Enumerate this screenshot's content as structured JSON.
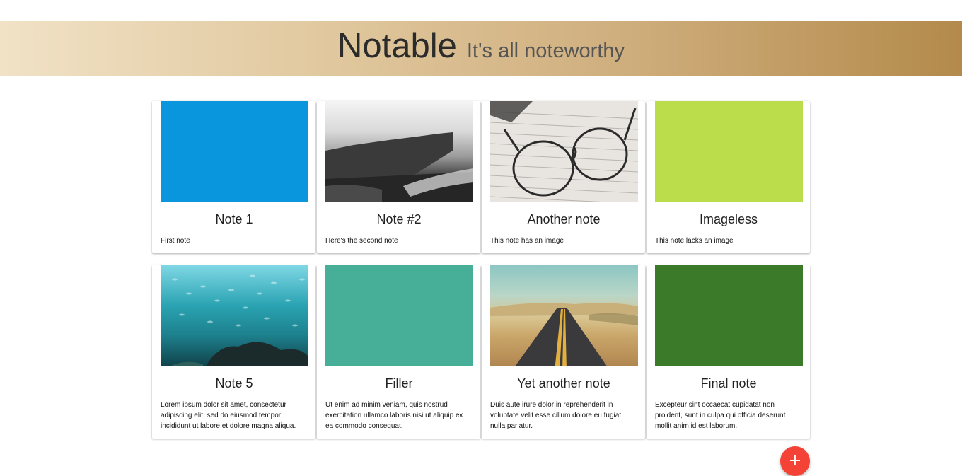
{
  "header": {
    "title": "Notable",
    "tagline": "It's all noteworthy"
  },
  "notes": [
    {
      "title": "Note 1",
      "text": "First note",
      "media": "solid-color",
      "color": "#0a96dd"
    },
    {
      "title": "Note #2",
      "text": "Here's the second note",
      "media": "photo-sea-cliffs-black-and-white"
    },
    {
      "title": "Another note",
      "text": "This note has an image",
      "media": "photo-eyeglasses-on-newspaper"
    },
    {
      "title": "Imageless",
      "text": "This note lacks an image",
      "media": "solid-color",
      "color": "#bbdd4c"
    },
    {
      "title": "Note 5",
      "text": "Lorem ipsum dolor sit amet, consectetur adipiscing elit, sed do eiusmod tempor incididunt ut labore et dolore magna aliqua.",
      "media": "photo-school-of-fish-reef"
    },
    {
      "title": "Filler",
      "text": "Ut enim ad minim veniam, quis nostrud exercitation ullamco laboris nisi ut aliquip ex ea commodo consequat.",
      "media": "solid-color",
      "color": "#47ae98"
    },
    {
      "title": "Yet another note",
      "text": "Duis aute irure dolor in reprehenderit in voluptate velit esse cillum dolore eu fugiat nulla pariatur.",
      "media": "photo-desert-road"
    },
    {
      "title": "Final note",
      "text": "Excepteur sint occaecat cupidatat non proident, sunt in culpa qui officia deserunt mollit anim id est laborum.",
      "media": "solid-color",
      "color": "#3a7a28"
    }
  ],
  "fab": {
    "icon": "plus-icon",
    "label": "+",
    "color": "#f44336"
  }
}
